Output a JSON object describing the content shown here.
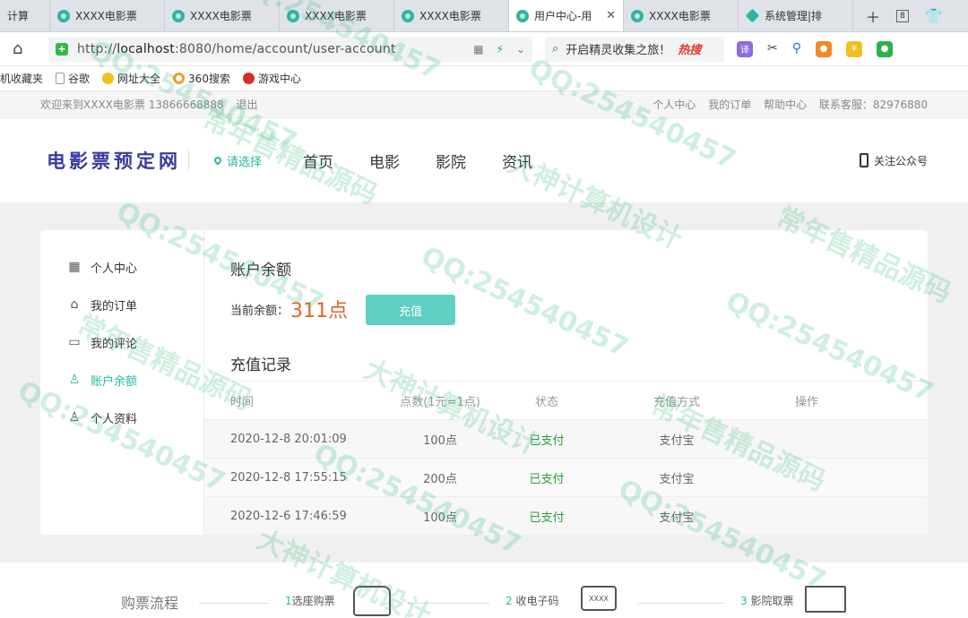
{
  "browser": {
    "tabs": [
      {
        "title": "计算",
        "active": false
      },
      {
        "title": "XXXX电影票",
        "active": false
      },
      {
        "title": "XXXX电影票",
        "active": false
      },
      {
        "title": "XXXX电影票",
        "active": false
      },
      {
        "title": "XXXX电影票",
        "active": false
      },
      {
        "title": "用户中心-用",
        "active": true
      },
      {
        "title": "XXXX电影票",
        "active": false
      },
      {
        "title": "系统管理|排",
        "active": false
      }
    ],
    "tab_count": "8",
    "url_prefix": "http://",
    "url_host": "localhost",
    "url_rest": ":8080/home/account/user-account",
    "search_text": "开启精灵收集之旅！",
    "search_hot": "热搜",
    "bookmarks": [
      "机收藏夹",
      "谷歌",
      "网址大全",
      "360搜索",
      "游戏中心"
    ],
    "ext_translate": "译"
  },
  "topbar": {
    "welcome": "欢迎来到XXXX电影票 13866668888",
    "logout": "退出",
    "links": [
      "个人中心",
      "我的订单",
      "帮助中心"
    ],
    "service": "联系客服：82976880"
  },
  "header": {
    "logo": "电影票预定网",
    "location": "请选择",
    "nav": [
      "首页",
      "电影",
      "影院",
      "资讯"
    ],
    "follow": "关注公众号"
  },
  "sidebar": {
    "items": [
      {
        "label": "个人中心",
        "icon": "grid-icon",
        "glyph": "▦",
        "active": false
      },
      {
        "label": "我的订单",
        "icon": "bag-icon",
        "glyph": "⌂",
        "active": false
      },
      {
        "label": "我的评论",
        "icon": "comment-icon",
        "glyph": "▭",
        "active": false
      },
      {
        "label": "账户余额",
        "icon": "wallet-icon",
        "glyph": "♙",
        "active": true
      },
      {
        "label": "个人资料",
        "icon": "user-icon",
        "glyph": "♙",
        "active": false
      }
    ]
  },
  "account": {
    "title": "账户余额",
    "balance_label": "当前余额：",
    "balance_value": "311点",
    "charge_button": "充值"
  },
  "records": {
    "title": "充值记录",
    "columns": [
      "时间",
      "点数(1元=1点)",
      "状态",
      "充值方式",
      "操作"
    ],
    "rows": [
      {
        "time": "2020-12-8 20:01:09",
        "points": "100点",
        "status": "已支付",
        "method": "支付宝",
        "action": ""
      },
      {
        "time": "2020-12-8 17:55:15",
        "points": "200点",
        "status": "已支付",
        "method": "支付宝",
        "action": ""
      },
      {
        "time": "2020-12-6 17:46:59",
        "points": "100点",
        "status": "已支付",
        "method": "支付宝",
        "action": ""
      }
    ]
  },
  "flow": {
    "title": "购票流程",
    "steps": [
      {
        "num": "1",
        "label": "选座购票"
      },
      {
        "num": "2",
        "label": "收电子码"
      },
      {
        "num": "3",
        "label": "影院取票"
      }
    ],
    "code_text": "XXXX"
  },
  "watermarks": [
    "QQ:254540457",
    "大神计算机设计",
    "常年售精品源码"
  ],
  "colors": {
    "accent": "#28b7a3",
    "balance": "#e0642a",
    "paid": "#2a9a3a",
    "button": "#5fcfc3"
  }
}
